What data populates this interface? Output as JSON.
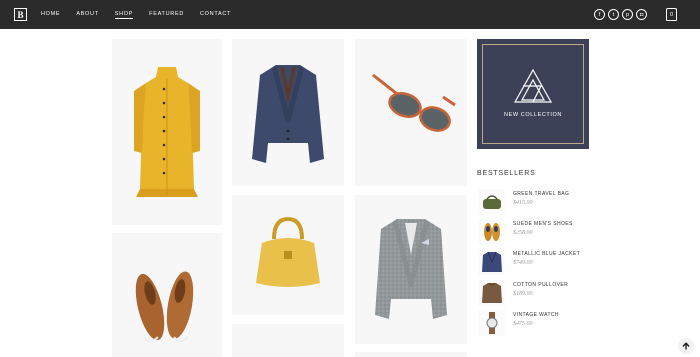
{
  "header": {
    "logo_text": "B",
    "nav": [
      "HOME",
      "ABOUT",
      "SHOP",
      "FEATURED",
      "CONTACT"
    ],
    "active_nav": "SHOP",
    "social_icons": [
      "facebook-icon",
      "twitter-icon",
      "pinterest-icon",
      "instagram-icon"
    ],
    "cart_count": "0"
  },
  "products": [
    {
      "name": "yellow-coat",
      "color": "#e8b52a"
    },
    {
      "name": "blue-blazer",
      "color": "#3e4a6b"
    },
    {
      "name": "sunglasses",
      "color": "#c8643a"
    },
    {
      "name": "yellow-handbag",
      "color": "#e9c04a"
    },
    {
      "name": "tweed-jacket",
      "color": "#8a8f92"
    },
    {
      "name": "brown-shoes",
      "color": "#a8632f"
    }
  ],
  "promo": {
    "label": "NEW COLLECTION",
    "background": "#3c4157",
    "frame_color": "#b9a98a"
  },
  "bestsellers": {
    "title": "BESTSELLERS",
    "items": [
      {
        "name": "GREEN TRAVEL BAG",
        "price": "$415.00",
        "icon": "bag"
      },
      {
        "name": "SUEDE MEN'S SHOES",
        "price": "$258.00",
        "icon": "shoes"
      },
      {
        "name": "METALLIC BLUE JACKET",
        "price": "$749.00",
        "icon": "jacket"
      },
      {
        "name": "COTTON PULLOVER",
        "price": "$189.00",
        "icon": "pullover"
      },
      {
        "name": "VINTAGE WATCH",
        "price": "$475.00",
        "icon": "watch"
      }
    ]
  },
  "back_to_top_icon": "arrow-up-icon"
}
